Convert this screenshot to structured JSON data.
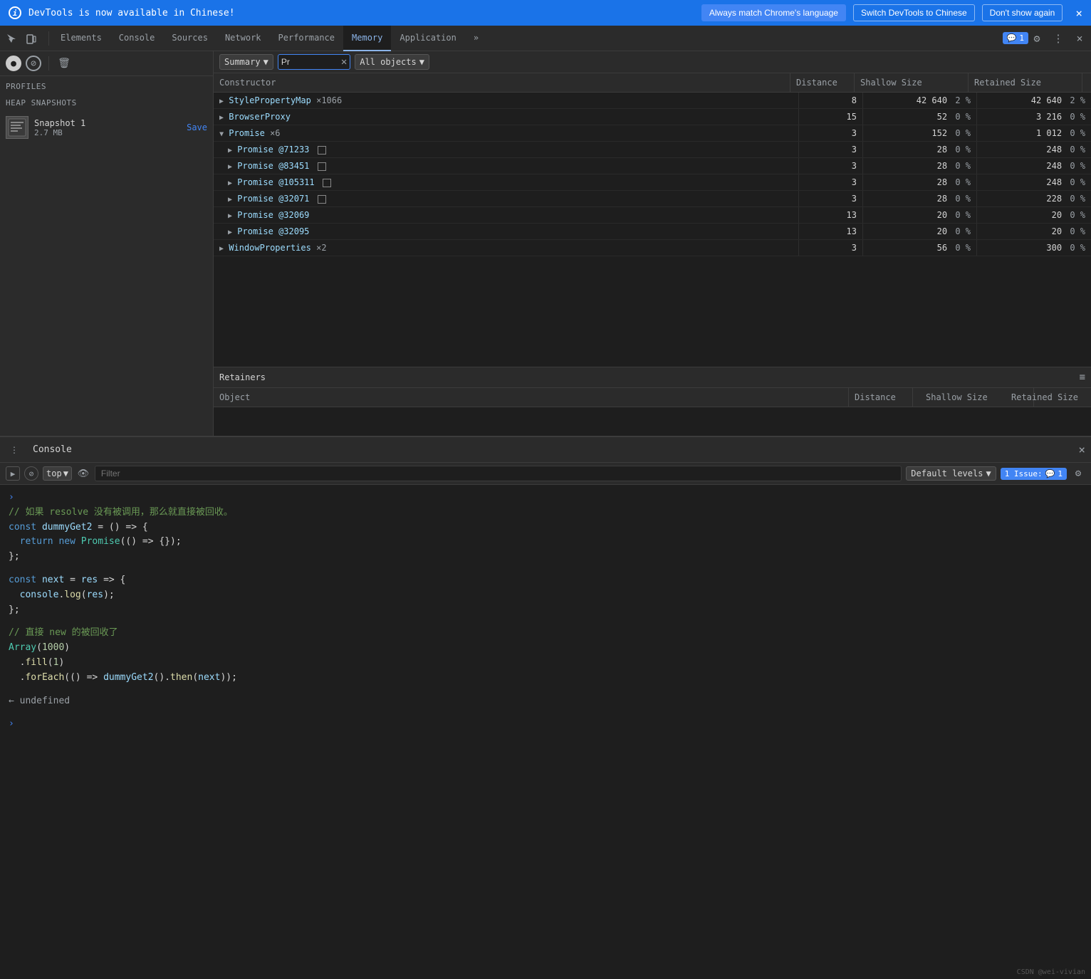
{
  "infoBar": {
    "text": "DevTools is now available in Chinese!",
    "btn1": "Always match Chrome's language",
    "btn2": "Switch DevTools to Chinese",
    "btn3": "Don't show again",
    "closeLabel": "×"
  },
  "tabs": {
    "items": [
      {
        "label": "Elements"
      },
      {
        "label": "Console"
      },
      {
        "label": "Sources"
      },
      {
        "label": "Network"
      },
      {
        "label": "Performance"
      },
      {
        "label": "Memory"
      },
      {
        "label": "Application"
      }
    ],
    "active": "Memory",
    "more": "»",
    "notification": "1",
    "notificationIcon": "💬"
  },
  "sidebar": {
    "profiles_title": "Profiles",
    "heap_title": "HEAP SNAPSHOTS",
    "snapshot": {
      "name": "Snapshot 1",
      "size": "2.7 MB",
      "save": "Save"
    }
  },
  "toolbar": {
    "view_label": "Summary",
    "search_value": "Pr",
    "filter_label": "All objects"
  },
  "tableHeader": {
    "constructor": "Constructor",
    "distance": "Distance",
    "shallow": "Shallow Size",
    "retained": "Retained Size"
  },
  "tableRows": [
    {
      "constructor": "StylePropertyMap",
      "count": "×1066",
      "distance": "8",
      "shallow": "42 640",
      "shallowPct": "2 %",
      "retained": "42 640",
      "retainedPct": "2 %",
      "expandable": true,
      "expanded": false,
      "indent": 0
    },
    {
      "constructor": "BrowserProxy",
      "count": "",
      "distance": "15",
      "shallow": "52",
      "shallowPct": "0 %",
      "retained": "3 216",
      "retainedPct": "0 %",
      "expandable": true,
      "expanded": false,
      "indent": 0
    },
    {
      "constructor": "Promise",
      "count": "×6",
      "distance": "3",
      "shallow": "152",
      "shallowPct": "0 %",
      "retained": "1 012",
      "retainedPct": "0 %",
      "expandable": true,
      "expanded": true,
      "indent": 0
    },
    {
      "constructor": "Promise @71233",
      "count": "",
      "distance": "3",
      "shallow": "28",
      "shallowPct": "0 %",
      "retained": "248",
      "retainedPct": "0 %",
      "expandable": true,
      "expanded": false,
      "indent": 1,
      "hasNodeIcon": true
    },
    {
      "constructor": "Promise @83451",
      "count": "",
      "distance": "3",
      "shallow": "28",
      "shallowPct": "0 %",
      "retained": "248",
      "retainedPct": "0 %",
      "expandable": true,
      "expanded": false,
      "indent": 1,
      "hasNodeIcon": true
    },
    {
      "constructor": "Promise @105311",
      "count": "",
      "distance": "3",
      "shallow": "28",
      "shallowPct": "0 %",
      "retained": "248",
      "retainedPct": "0 %",
      "expandable": true,
      "expanded": false,
      "indent": 1,
      "hasNodeIcon": true
    },
    {
      "constructor": "Promise @32071",
      "count": "",
      "distance": "3",
      "shallow": "28",
      "shallowPct": "0 %",
      "retained": "228",
      "retainedPct": "0 %",
      "expandable": true,
      "expanded": false,
      "indent": 1,
      "hasNodeIcon": true
    },
    {
      "constructor": "Promise @32069",
      "count": "",
      "distance": "13",
      "shallow": "20",
      "shallowPct": "0 %",
      "retained": "20",
      "retainedPct": "0 %",
      "expandable": true,
      "expanded": false,
      "indent": 1
    },
    {
      "constructor": "Promise @32095",
      "count": "",
      "distance": "13",
      "shallow": "20",
      "shallowPct": "0 %",
      "retained": "20",
      "retainedPct": "0 %",
      "expandable": true,
      "expanded": false,
      "indent": 1
    },
    {
      "constructor": "WindowProperties",
      "count": "×2",
      "distance": "3",
      "shallow": "56",
      "shallowPct": "0 %",
      "retained": "300",
      "retainedPct": "0 %",
      "expandable": true,
      "expanded": false,
      "indent": 0
    }
  ],
  "retainers": {
    "title": "Retainers",
    "columns": {
      "object": "Object",
      "distance": "Distance",
      "shallow": "Shallow Size",
      "retained": "Retained Size"
    }
  },
  "console": {
    "tab_label": "Console",
    "filter_placeholder": "Filter",
    "levels_label": "Default levels",
    "issues_label": "1 Issue:",
    "issues_count": "1",
    "top_label": "top",
    "code_blocks": [
      {
        "lines": [
          "// 如果 resolve 没有被调用，那么就直接被回收。",
          "const dummyGet2 = () => {",
          "  return new Promise(() => {});",
          "};"
        ]
      },
      {
        "lines": [
          "const next = res => {",
          "  console.log(res);",
          "};"
        ]
      },
      {
        "lines": [
          "// 直接 new 的被回收了",
          "Array(1000)",
          "  .fill(1)",
          "  .forEach(() => dummyGet2().then(next));"
        ]
      }
    ],
    "result": "← undefined"
  },
  "watermark": "CSDN @wei-vivian"
}
